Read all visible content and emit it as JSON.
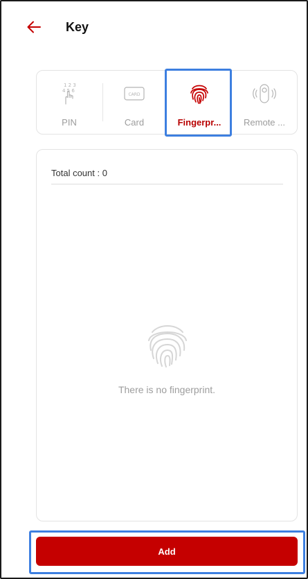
{
  "header": {
    "title": "Key",
    "back_icon": "arrow-left-icon",
    "accent_color": "#c50000"
  },
  "key_tabs": {
    "selected": "Fingerpr...",
    "items": [
      {
        "label": "PIN",
        "icon": "keypad-touch-icon"
      },
      {
        "label": "Card",
        "icon": "card-icon"
      },
      {
        "label": "Fingerpr...",
        "icon": "fingerprint-icon"
      },
      {
        "label": "Remote ...",
        "icon": "remote-control-icon"
      }
    ]
  },
  "list_panel": {
    "total_count": "Total count : 0",
    "empty_icon": "fingerprint-icon",
    "empty_message": "There is no fingerprint."
  },
  "footer": {
    "add_label": "Add"
  },
  "colors": {
    "accent": "#c50000",
    "active_tab_text": "#b80000",
    "inactive_text": "#9c9c9c",
    "highlight_box": "#3d7fe0"
  }
}
